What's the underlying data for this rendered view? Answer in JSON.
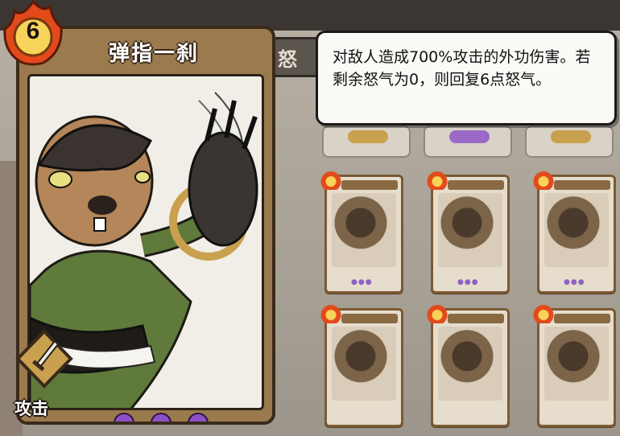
{
  "card": {
    "title": "弹指一刹",
    "cost": "6",
    "type_label": "攻击",
    "energy_count": 3,
    "energy_icon": "purple-comma-icon",
    "type_icon": "sword-icon",
    "cost_icon": "flame-icon"
  },
  "tooltip": {
    "description": "对敌人造成700%攻击的外功伤害。若剩余怒气为0，则回复6点怒气。"
  },
  "background": {
    "header_glyph": "怒",
    "tabs": [
      "",
      "",
      ""
    ],
    "grid_cards": 6
  },
  "colors": {
    "card_frame": "#9b7a4e",
    "energy": "#8e4fc9",
    "flame_outer": "#e24a1c",
    "flame_inner": "#f8d35a"
  }
}
